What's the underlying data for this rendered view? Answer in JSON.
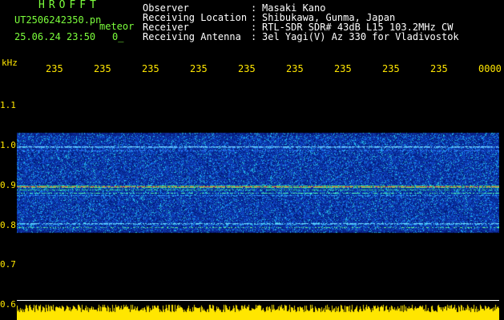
{
  "header": {
    "logo": "HROFFT",
    "filename": "UT2506242350.pn",
    "filename_suffix": "meteor",
    "datetime": "25.06.24 23:50",
    "count": "0_",
    "fields": [
      {
        "label": "Observer",
        "value": "Masaki Kano"
      },
      {
        "label": "Receiving Location",
        "value": "Shibukawa, Gunma, Japan"
      },
      {
        "label": "Receiver",
        "value": "RTL-SDR SDR# 43dB L15 103.2MHz CW"
      },
      {
        "label": "Receiving Antenna",
        "value": "3el Yagi(V) Az 330 for Vladivostok"
      }
    ],
    "separator": ":"
  },
  "axis": {
    "unit": "kHz",
    "time_ticks": [
      "235",
      "235",
      "235",
      "235",
      "235",
      "235",
      "235",
      "235",
      "235",
      "0000"
    ],
    "freq_ticks": [
      "1.1",
      "1.0",
      "0.9",
      "0.8",
      "0.7",
      "0.6"
    ]
  },
  "colors": {
    "header_green": "#7CFF3C",
    "header_white": "#FFFFFF",
    "axis_yellow": "#FFE600",
    "spectrogram_base": "#1A3DC8",
    "noise_amplitude": "#FFE600"
  }
}
